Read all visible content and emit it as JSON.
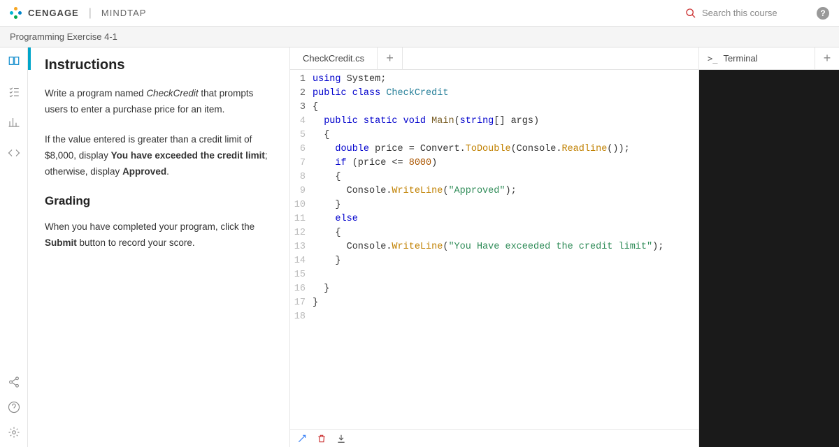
{
  "header": {
    "brand": "CENGAGE",
    "product": "MINDTAP",
    "search_placeholder": "Search this course",
    "help_glyph": "?"
  },
  "breadcrumb": "Programming Exercise 4-1",
  "rail": {
    "items": [
      "book",
      "checklist",
      "chart",
      "code"
    ],
    "bottom": [
      "share",
      "help",
      "settings"
    ]
  },
  "instructions": {
    "title": "Instructions",
    "para1_a": "Write a program named ",
    "para1_em": "CheckCredit",
    "para1_b": " that prompts users to enter a purchase price for an item.",
    "para2_a": "If the value entered is greater than a credit limit of $8,000, display ",
    "para2_bold1": "You have exceeded the credit limit",
    "para2_mid": "; otherwise, display ",
    "para2_bold2": "Approved",
    "para2_end": ".",
    "grading_title": "Grading",
    "para3_a": "When you have completed your program, click the ",
    "para3_bold": "Submit",
    "para3_b": " button to record your score."
  },
  "editor": {
    "tab_label": "CheckCredit.cs",
    "add_glyph": "+",
    "line_numbers": [
      "1",
      "2",
      "3",
      "4",
      "5",
      "6",
      "7",
      "8",
      "9",
      "10",
      "11",
      "12",
      "13",
      "14",
      "15",
      "16",
      "17",
      "18"
    ],
    "code": {
      "l1_kw1": "using",
      "l1_ns": " System;",
      "l2_kw1": "public",
      "l2_kw2": " class",
      "l2_cls": " CheckCredit",
      "l3": "{",
      "l4_pad": "  ",
      "l4_kw1": "public",
      "l4_kw2": " static",
      "l4_kw3": " void",
      "l4_fn": " Main",
      "l4_sig": "(",
      "l4_kw4": "string",
      "l4_sig2": "[] args)",
      "l5": "  {",
      "l6_pad": "    ",
      "l6_kw": "double",
      "l6_a": " price = Convert.",
      "l6_m1": "ToDouble",
      "l6_b": "(Console.",
      "l6_m2": "Readline",
      "l6_c": "());",
      "l7_pad": "    ",
      "l7_kw": "if",
      "l7_a": " (price <= ",
      "l7_num": "8000",
      "l7_b": ")",
      "l8": "    {",
      "l9_pad": "      ",
      "l9_a": "Console.",
      "l9_m": "WriteLine",
      "l9_b": "(",
      "l9_str": "\"Approved\"",
      "l9_c": ");",
      "l10": "    }",
      "l11_pad": "    ",
      "l11_kw": "else",
      "l12": "    {",
      "l13_pad": "      ",
      "l13_a": "Console.",
      "l13_m": "WriteLine",
      "l13_b": "(",
      "l13_str": "\"You Have exceeded the credit limit\"",
      "l13_c": ");",
      "l14": "    }",
      "l15": "",
      "l16": "  }",
      "l17": "}",
      "l18": ""
    }
  },
  "terminal": {
    "prompt_glyph": ">_",
    "label": "Terminal",
    "add_glyph": "+"
  }
}
